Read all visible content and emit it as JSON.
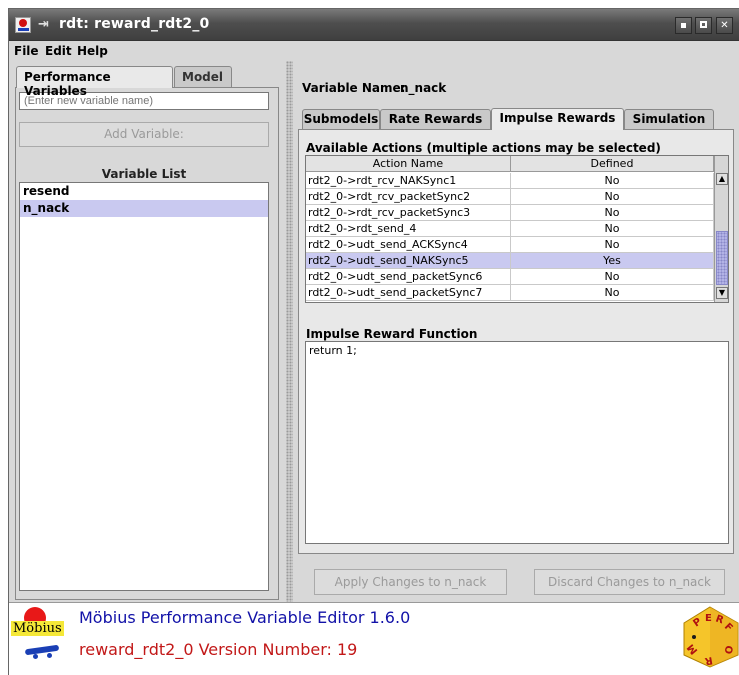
{
  "window": {
    "title": "rdt: reward_rdt2_0",
    "pin_glyph": "⇥",
    "controls": [
      "minimize",
      "maximize",
      "close"
    ],
    "close_glyph": "✕"
  },
  "menu": [
    "File",
    "Edit",
    "Help"
  ],
  "left": {
    "tabs": [
      "Performance Variables",
      "Model"
    ],
    "active_tab": "Performance Variables",
    "new_variable_placeholder": "(Enter new variable name)",
    "add_button": "Add Variable:",
    "list_title": "Variable List",
    "variables": [
      "resend",
      "n_nack"
    ],
    "selected_variable": "n_nack"
  },
  "right": {
    "variable_name_label": "Variable Name:",
    "variable_name": "n_nack",
    "tabs": [
      "Submodels",
      "Rate Rewards",
      "Impulse Rewards",
      "Simulation"
    ],
    "active_tab": "Impulse Rewards",
    "actions_title": "Available Actions (multiple actions may be selected)",
    "table": {
      "columns": [
        "Action Name",
        "Defined"
      ],
      "rows": [
        {
          "action": "rdt2_0->rdt_rcv_NAKSync1",
          "defined": "No"
        },
        {
          "action": "rdt2_0->rdt_rcv_packetSync2",
          "defined": "No"
        },
        {
          "action": "rdt2_0->rdt_rcv_packetSync3",
          "defined": "No"
        },
        {
          "action": "rdt2_0->rdt_send_4",
          "defined": "No"
        },
        {
          "action": "rdt2_0->udt_send_ACKSync4",
          "defined": "No"
        },
        {
          "action": "rdt2_0->udt_send_NAKSync5",
          "defined": "Yes"
        },
        {
          "action": "rdt2_0->udt_send_packetSync6",
          "defined": "No"
        },
        {
          "action": "rdt2_0->udt_send_packetSync7",
          "defined": "No"
        }
      ],
      "selected_row": 5
    },
    "impulse_title": "Impulse Reward Function",
    "impulse_code": "return 1;",
    "apply_button": "Apply Changes to n_nack",
    "discard_button": "Discard Changes to n_nack"
  },
  "footer": {
    "logo_text": "Möbius",
    "editor_line": "Möbius Performance Variable Editor 1.6.0",
    "version_line": "reward_rdt2_0  Version Number:  19",
    "perf_logo_letters": [
      "P",
      "E",
      "R",
      "F",
      "O",
      "R",
      "M"
    ]
  },
  "colors": {
    "selection": "#c9c9f0",
    "footer_blue": "#1212a8",
    "footer_red": "#c21818",
    "titlebar": "#4e4e4e"
  }
}
